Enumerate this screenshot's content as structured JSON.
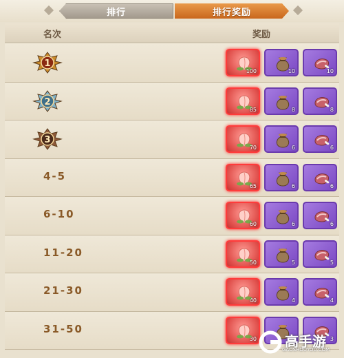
{
  "tabs": [
    {
      "label": "排行",
      "active": false
    },
    {
      "label": "排行奖励",
      "active": true
    }
  ],
  "headers": {
    "rank": "名次",
    "reward": "奖励"
  },
  "rows": [
    {
      "rank": "1",
      "medal": "gold-medal",
      "rewards": [
        {
          "type": "peach",
          "qty": "100",
          "rarity": "red"
        },
        {
          "type": "sack",
          "qty": "10",
          "rarity": "purple"
        },
        {
          "type": "meat",
          "qty": "10",
          "rarity": "purple"
        }
      ]
    },
    {
      "rank": "2",
      "medal": "silver-medal",
      "rewards": [
        {
          "type": "peach",
          "qty": "85",
          "rarity": "red"
        },
        {
          "type": "sack",
          "qty": "8",
          "rarity": "purple"
        },
        {
          "type": "meat",
          "qty": "8",
          "rarity": "purple"
        }
      ]
    },
    {
      "rank": "3",
      "medal": "bronze-medal",
      "rewards": [
        {
          "type": "peach",
          "qty": "70",
          "rarity": "red"
        },
        {
          "type": "sack",
          "qty": "6",
          "rarity": "purple"
        },
        {
          "type": "meat",
          "qty": "6",
          "rarity": "purple"
        }
      ]
    },
    {
      "rank": "4-5",
      "rewards": [
        {
          "type": "peach",
          "qty": "65",
          "rarity": "red"
        },
        {
          "type": "sack",
          "qty": "6",
          "rarity": "purple"
        },
        {
          "type": "meat",
          "qty": "6",
          "rarity": "purple"
        }
      ]
    },
    {
      "rank": "6-10",
      "rewards": [
        {
          "type": "peach",
          "qty": "60",
          "rarity": "red"
        },
        {
          "type": "sack",
          "qty": "6",
          "rarity": "purple"
        },
        {
          "type": "meat",
          "qty": "6",
          "rarity": "purple"
        }
      ]
    },
    {
      "rank": "11-20",
      "rewards": [
        {
          "type": "peach",
          "qty": "50",
          "rarity": "red"
        },
        {
          "type": "sack",
          "qty": "5",
          "rarity": "purple"
        },
        {
          "type": "meat",
          "qty": "5",
          "rarity": "purple"
        }
      ]
    },
    {
      "rank": "21-30",
      "rewards": [
        {
          "type": "peach",
          "qty": "40",
          "rarity": "red"
        },
        {
          "type": "sack",
          "qty": "4",
          "rarity": "purple"
        },
        {
          "type": "meat",
          "qty": "4",
          "rarity": "purple"
        }
      ]
    },
    {
      "rank": "31-50",
      "rewards": [
        {
          "type": "peach",
          "qty": "30",
          "rarity": "red"
        },
        {
          "type": "sack",
          "qty": "3",
          "rarity": "purple"
        },
        {
          "type": "meat",
          "qty": "3",
          "rarity": "purple"
        }
      ]
    }
  ],
  "watermark": {
    "title": "高手游",
    "sub": "GAOSHOUYOU.COM"
  },
  "colors": {
    "gold": "#c98a2a",
    "silver": "#7fb2c9",
    "bronze": "#8f5a3a",
    "rank_text": "#8a5a28",
    "active_tab": "#d97a2c"
  }
}
